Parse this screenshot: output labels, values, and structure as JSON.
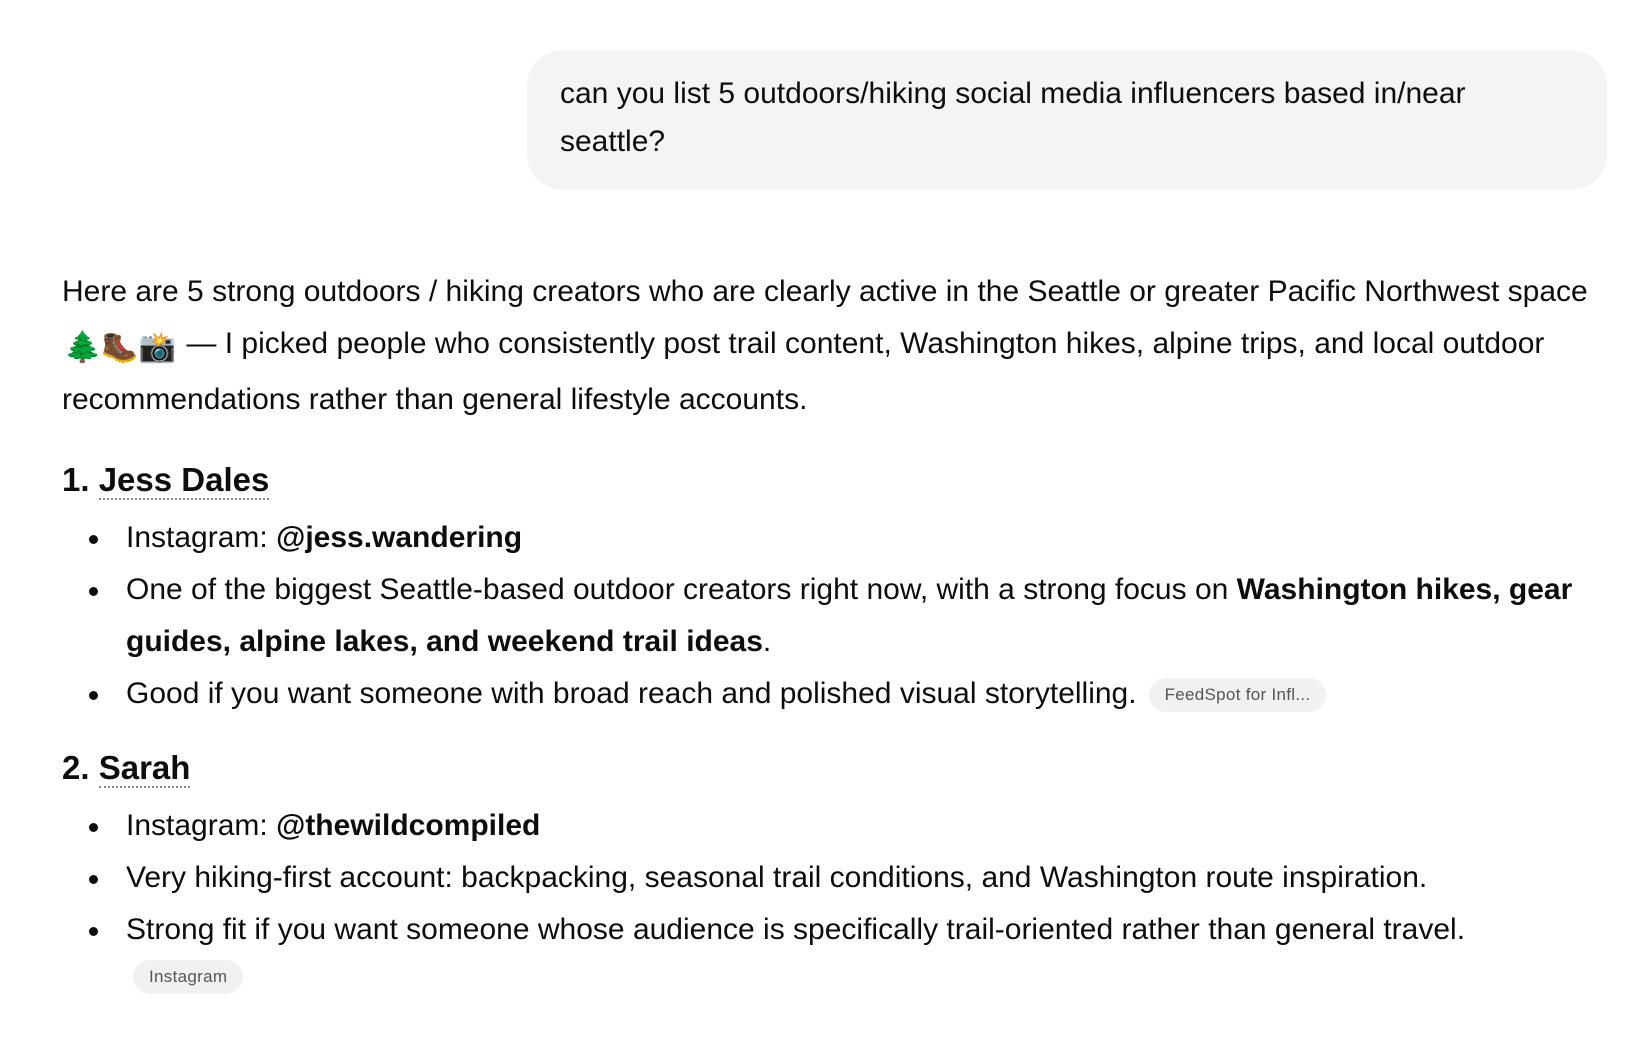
{
  "user_message": {
    "text": "can you list 5 outdoors/hiking social media influencers based in/near seattle?"
  },
  "assistant": {
    "intro_before_emoji": "Here are 5 strong outdoors / hiking creators who are clearly active in the Seattle or greater Pacific Northwest space ",
    "intro_emoji": "🌲🥾📸",
    "intro_after_emoji": " — I picked people who consistently post trail content, Washington hikes, alpine trips, and local outdoor recommendations rather than general lifestyle accounts.",
    "entries": [
      {
        "number": "1.",
        "name": "Jess Dales",
        "instagram_label": "Instagram: ",
        "instagram_handle": "@jess.wandering",
        "bullet2_prefix": "One of the biggest Seattle-based outdoor creators right now, with a strong focus on ",
        "bullet2_bold": "Washington hikes, gear guides, alpine lakes, and weekend trail ideas",
        "bullet2_suffix": ".",
        "bullet3": "Good if you want someone with broad reach and polished visual storytelling.",
        "source": "FeedSpot for Infl..."
      },
      {
        "number": "2.",
        "name": "Sarah",
        "instagram_label": "Instagram: ",
        "instagram_handle": "@thewildcompiled",
        "bullet2": "Very hiking-first account: backpacking, seasonal trail conditions, and Washington route inspiration.",
        "bullet3": "Strong fit if you want someone whose audience is specifically trail-oriented rather than general travel.",
        "source": "Instagram"
      }
    ]
  }
}
